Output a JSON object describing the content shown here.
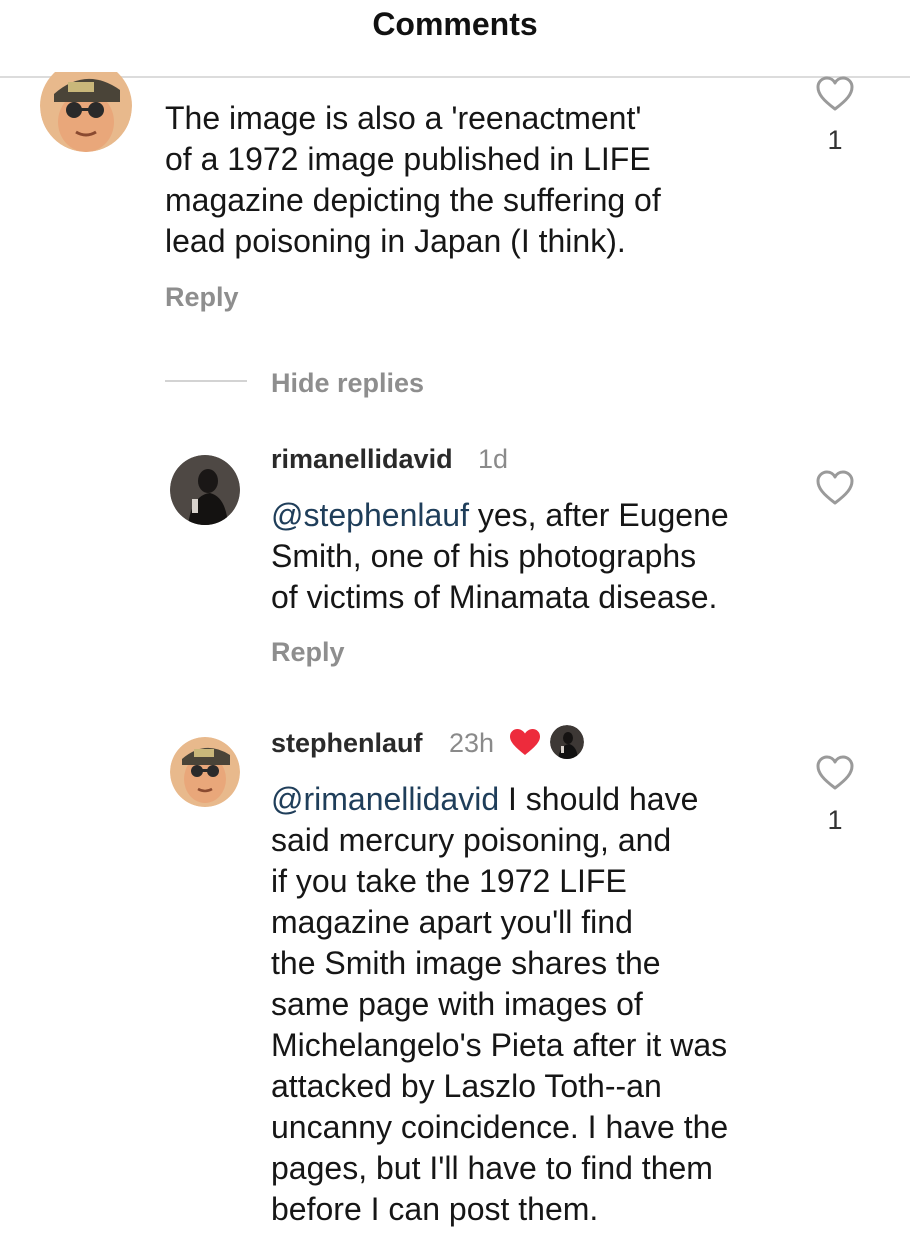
{
  "header": {
    "title": "Comments"
  },
  "comments": [
    {
      "lines": [
        "The image is also a 'reenactment'",
        "of a 1972 image published in LIFE",
        "magazine depicting the suffering of",
        "lead poisoning in Japan (I think)."
      ],
      "reply_label": "Reply",
      "likes": "1",
      "avatar_icon": "avatar-man-cap-glasses"
    }
  ],
  "hide_replies_label": "Hide replies",
  "replies": [
    {
      "username": "rimanellidavid",
      "time": "1d",
      "mention": "@stephenlauf",
      "lines": [
        " yes, after Eugene",
        "Smith, one of his photographs",
        "of victims of Minamata disease."
      ],
      "reply_label": "Reply",
      "avatar_icon": "avatar-dark-portrait"
    },
    {
      "username": "stephenlauf",
      "time": "23h",
      "mention": "@rimanellidavid",
      "lines": [
        " I should have",
        "said mercury poisoning, and",
        "if you take the 1972 LIFE",
        "magazine apart you'll find",
        "the Smith image shares the",
        "same page with images of",
        "Michelangelo's Pieta after it was",
        "attacked by Laszlo Toth--an",
        "uncanny coincidence. I have the",
        "pages, but I'll have to find them",
        "before I can post them."
      ],
      "likes": "1",
      "liked_by_author_icon": "heart-filled-icon",
      "avatar_icon": "avatar-man-cap-glasses"
    }
  ],
  "colors": {
    "mention": "#1f3e5a",
    "liked_heart": "#ed2b3c",
    "muted_text": "#8e8e8e"
  }
}
